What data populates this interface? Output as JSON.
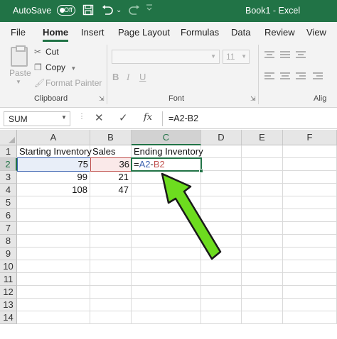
{
  "titlebar": {
    "autosave_label": "AutoSave",
    "autosave_state": "Off",
    "save_icon": "save-icon",
    "undo_icon": "undo-icon",
    "redo_icon": "redo-icon",
    "title": "Book1  -  Excel",
    "color": "#217346"
  },
  "ribbon_tabs": [
    "File",
    "Home",
    "Insert",
    "Page Layout",
    "Formulas",
    "Data",
    "Review",
    "View"
  ],
  "active_tab": "Home",
  "clipboard": {
    "paste_label": "Paste",
    "cut_label": "Cut",
    "copy_label": "Copy",
    "format_painter_label": "Format Painter",
    "group_label": "Clipboard"
  },
  "font_group": {
    "font_name": "",
    "font_size": "11",
    "bold": "B",
    "italic": "I",
    "underline": "U",
    "group_label": "Font"
  },
  "alignment_group": {
    "group_label": "Alig"
  },
  "formula_bar": {
    "name_box": "SUM",
    "cancel": "✕",
    "enter": "✓",
    "fx": "fx",
    "formula": "=A2-B2"
  },
  "sheet": {
    "columns": [
      "A",
      "B",
      "C",
      "D",
      "E",
      "F"
    ],
    "selected_column": "C",
    "rows": [
      "1",
      "2",
      "3",
      "4",
      "5",
      "6",
      "7",
      "8",
      "9",
      "10",
      "11",
      "12",
      "13",
      "14"
    ],
    "selected_row": "2",
    "cells": {
      "A1": "Starting Inventory",
      "B1": "Sales",
      "C1": "Ending Inventory",
      "A2": "75",
      "B2": "36",
      "A3": "99",
      "B3": "21",
      "A4": "108",
      "B4": "47"
    },
    "editing_cell": {
      "address": "C2",
      "prefix": "=",
      "ref1": "A2",
      "operator": "-",
      "ref2": "B2"
    },
    "annotation_color": "#6ddc1f"
  }
}
